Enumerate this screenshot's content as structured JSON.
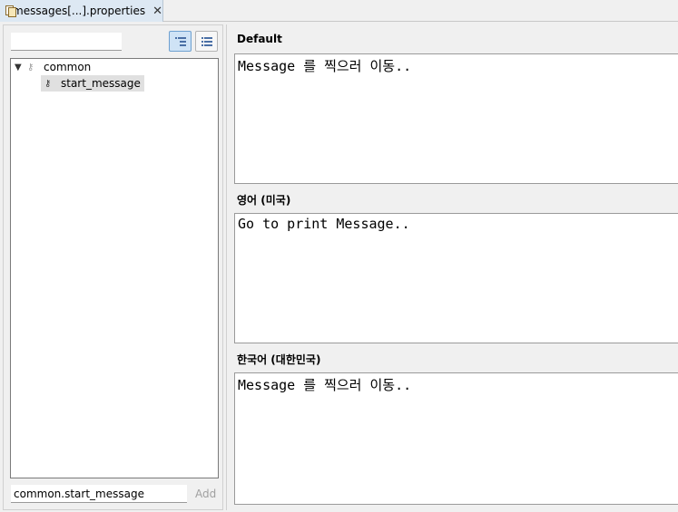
{
  "editor_tab": {
    "title": "messages[...].properties",
    "close_glyph": "✕"
  },
  "left_panel": {
    "filter_placeholder": "",
    "toolbar": {
      "tree_view_icon": "tree-view-icon",
      "flat_view_icon": "flat-view-icon",
      "tree_view_active": true
    },
    "tree": {
      "group": {
        "label": "common",
        "expanded": true
      },
      "items": [
        {
          "label": "start_message",
          "selected": true
        }
      ]
    },
    "new_key_value": "common.start_message",
    "add_label": "Add"
  },
  "right_panel": {
    "locales": [
      {
        "label": "Default",
        "value": "Message 를 찍으러 이동.."
      },
      {
        "label": "영어 (미국)",
        "value": "Go to print Message.."
      },
      {
        "label": "한국어 (대한민국)",
        "value": "Message 를 찍으러 이동.."
      }
    ]
  }
}
